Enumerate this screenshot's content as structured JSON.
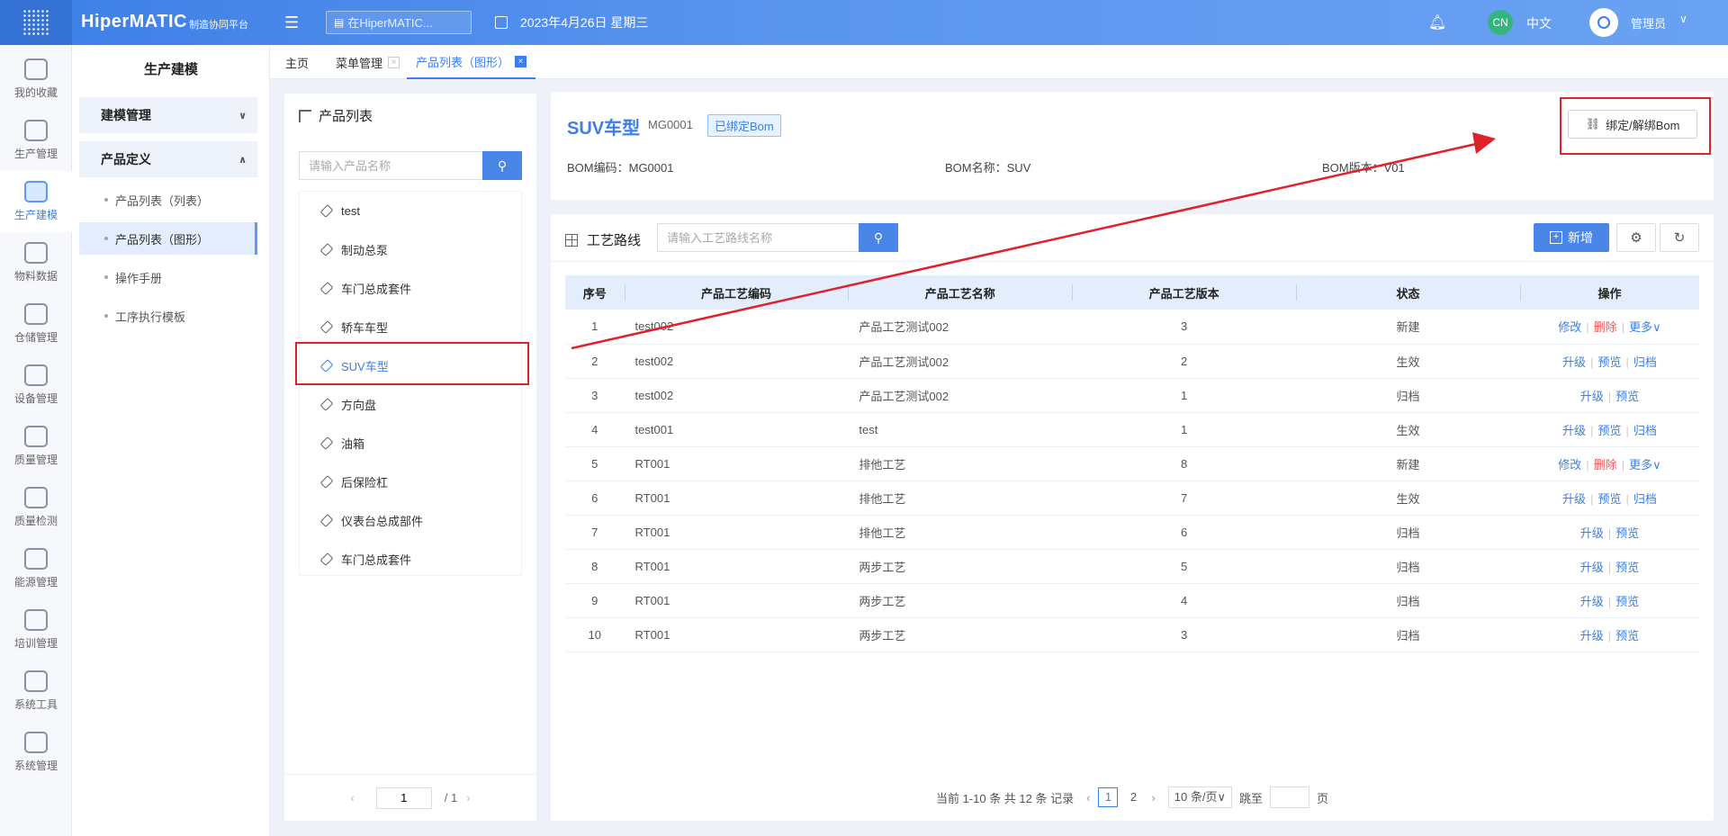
{
  "topbar": {
    "brand": "HiperMATIC",
    "brand_sub": "制造协同平台",
    "search_placeholder": "在HiperMATIC...",
    "date": "2023年4月26日 星期三",
    "lang_badge": "CN",
    "lang": "中文",
    "user": "管理员"
  },
  "leftnav": [
    {
      "label": "我的收藏",
      "icon": "star-icon"
    },
    {
      "label": "生产管理",
      "icon": "factory-icon"
    },
    {
      "label": "生产建模",
      "icon": "cube-icon",
      "active": true
    },
    {
      "label": "物料数据",
      "icon": "package-icon"
    },
    {
      "label": "仓储管理",
      "icon": "warehouse-icon"
    },
    {
      "label": "设备管理",
      "icon": "equipment-icon"
    },
    {
      "label": "质量管理",
      "icon": "shield-check-icon"
    },
    {
      "label": "质量检测",
      "icon": "inspection-icon"
    },
    {
      "label": "能源管理",
      "icon": "recycle-icon"
    },
    {
      "label": "培训管理",
      "icon": "training-icon"
    },
    {
      "label": "系统工具",
      "icon": "network-icon"
    },
    {
      "label": "系统管理",
      "icon": "settings-cube-icon"
    }
  ],
  "subnav": {
    "title": "生产建模",
    "groups": [
      {
        "label": "建模管理",
        "expanded": false
      },
      {
        "label": "产品定义",
        "expanded": true
      }
    ],
    "items": [
      {
        "label": "产品列表（列表）"
      },
      {
        "label": "产品列表（图形）",
        "active": true
      },
      {
        "label": "操作手册"
      },
      {
        "label": "工序执行模板"
      }
    ]
  },
  "tabs": [
    {
      "label": "主页"
    },
    {
      "label": "菜单管理"
    },
    {
      "label": "产品列表（图形）",
      "active": true
    }
  ],
  "product_list": {
    "title": "产品列表",
    "search_placeholder": "请输入产品名称",
    "items": [
      "test",
      "制动总泵",
      "车门总成套件",
      "轿车车型",
      "SUV车型",
      "方向盘",
      "油箱",
      "后保险杠",
      "仪表台总成部件",
      "车门总成套件"
    ],
    "selected": "SUV车型",
    "pager": {
      "page": "1",
      "total": "/ 1"
    }
  },
  "bom": {
    "name": "SUV车型",
    "code": "MG0001",
    "badge": "已绑定Bom",
    "code_label": "BOM编码：MG0001",
    "name_label": "BOM名称：SUV",
    "version_label": "BOM版本：V01",
    "bind_button": "绑定/解绑Bom"
  },
  "route": {
    "title": "工艺路线",
    "search_placeholder": "请输入工艺路线名称",
    "add_button": "新增",
    "columns": [
      "序号",
      "产品工艺编码",
      "产品工艺名称",
      "产品工艺版本",
      "状态",
      "操作"
    ],
    "rows": [
      {
        "no": "1",
        "code": "test002",
        "name": "产品工艺测试002",
        "version": "3",
        "status": "新建",
        "ops": [
          "修改",
          "删除",
          "更多∨"
        ]
      },
      {
        "no": "2",
        "code": "test002",
        "name": "产品工艺测试002",
        "version": "2",
        "status": "生效",
        "ops": [
          "升级",
          "预览",
          "归档"
        ]
      },
      {
        "no": "3",
        "code": "test002",
        "name": "产品工艺测试002",
        "version": "1",
        "status": "归档",
        "ops": [
          "升级",
          "预览"
        ]
      },
      {
        "no": "4",
        "code": "test001",
        "name": "test",
        "version": "1",
        "status": "生效",
        "ops": [
          "升级",
          "预览",
          "归档"
        ]
      },
      {
        "no": "5",
        "code": "RT001",
        "name": "排他工艺",
        "version": "8",
        "status": "新建",
        "ops": [
          "修改",
          "删除",
          "更多∨"
        ]
      },
      {
        "no": "6",
        "code": "RT001",
        "name": "排他工艺",
        "version": "7",
        "status": "生效",
        "ops": [
          "升级",
          "预览",
          "归档"
        ]
      },
      {
        "no": "7",
        "code": "RT001",
        "name": "排他工艺",
        "version": "6",
        "status": "归档",
        "ops": [
          "升级",
          "预览"
        ]
      },
      {
        "no": "8",
        "code": "RT001",
        "name": "两步工艺",
        "version": "5",
        "status": "归档",
        "ops": [
          "升级",
          "预览"
        ]
      },
      {
        "no": "9",
        "code": "RT001",
        "name": "两步工艺",
        "version": "4",
        "status": "归档",
        "ops": [
          "升级",
          "预览"
        ]
      },
      {
        "no": "10",
        "code": "RT001",
        "name": "两步工艺",
        "version": "3",
        "status": "归档",
        "ops": [
          "升级",
          "预览"
        ]
      }
    ],
    "pager": {
      "summary": "当前 1-10 条 共 12 条 记录",
      "pages": [
        "1",
        "2"
      ],
      "current": "1",
      "page_size": "10 条/页∨",
      "jump_label": "跳至",
      "page_unit": "页"
    }
  },
  "colors": {
    "accent": "#3d7fe6",
    "annotation": "#e0202a",
    "danger": "#e85c5c"
  }
}
